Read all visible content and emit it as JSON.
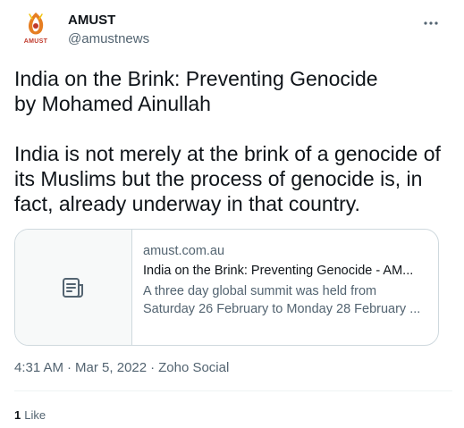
{
  "author": {
    "name": "AMUST",
    "handle": "@amustnews",
    "avatar_text": "AMUST",
    "brand_colors": [
      "#e67e22",
      "#c0392b",
      "#f1c40f"
    ]
  },
  "more_icon": "more-horizontal-icon",
  "tweet": {
    "text": "India on the Brink: Preventing Genocide\nby Mohamed Ainullah\n\nIndia is not merely at the brink of a genocide of its Muslims but the process of genocide is, in fact, already underway in that country."
  },
  "card": {
    "icon": "article-icon",
    "domain": "amust.com.au",
    "title": "India on the Brink: Preventing Genocide - AM...",
    "description": "A three day global summit was held  from Saturday 26 February to Monday 28 February ..."
  },
  "meta": {
    "time": "4:31 AM",
    "separator1": "·",
    "date": "Mar 5, 2022",
    "separator2": "·",
    "source": "Zoho Social"
  },
  "stats": {
    "likes_count": "1",
    "likes_label": "Like"
  }
}
